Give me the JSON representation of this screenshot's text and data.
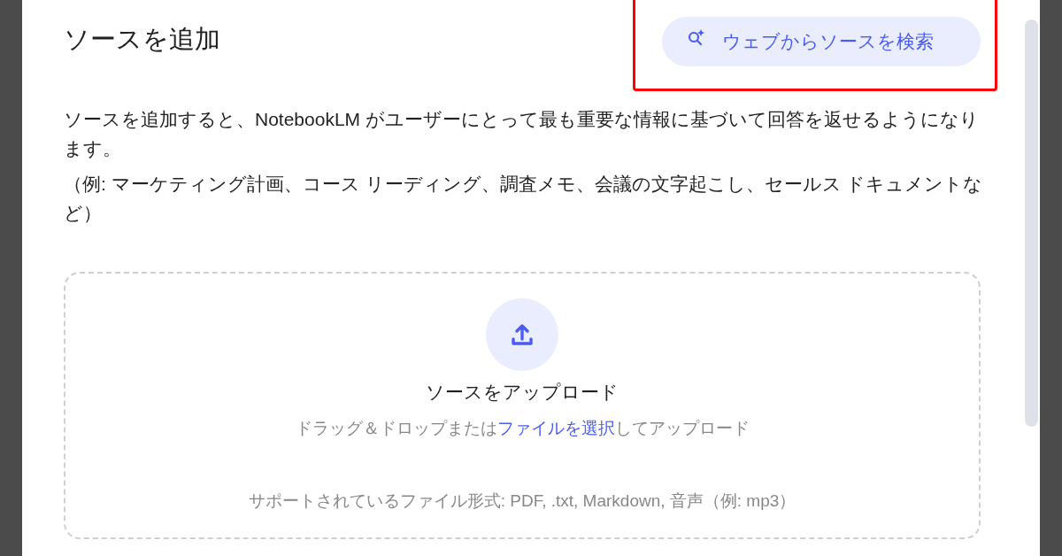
{
  "dialog": {
    "title": "ソースを追加",
    "web_search_button": {
      "label": "ウェブからソースを検索",
      "highlighted": true
    },
    "description": [
      "ソースを追加すると、NotebookLM がユーザーにとって最も重要な情報に基づいて回答を返せるようになります。",
      "（例: マーケティング計画、コース リーディング、調査メモ、会議の文字起こし、セールス ドキュメントなど）"
    ],
    "upload": {
      "title": "ソースをアップロード",
      "hint": {
        "before": "ドラッグ＆ドロップまたは",
        "link": "ファイルを選択",
        "after": "してアップロード"
      },
      "supported": "サポートされているファイル形式: PDF, .txt, Markdown, 音声（例: mp3）"
    }
  }
}
